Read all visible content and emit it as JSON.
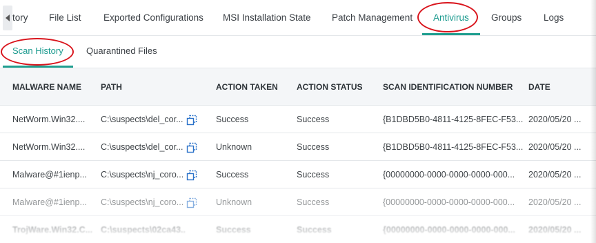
{
  "tabs": [
    {
      "label": "tory"
    },
    {
      "label": "File List"
    },
    {
      "label": "Exported Configurations"
    },
    {
      "label": "MSI Installation State"
    },
    {
      "label": "Patch Management"
    },
    {
      "label": "Antivirus",
      "active": true
    },
    {
      "label": "Groups"
    },
    {
      "label": "Logs"
    }
  ],
  "subtabs": [
    {
      "label": "Scan History",
      "active": true
    },
    {
      "label": "Quarantined Files"
    }
  ],
  "table": {
    "columns": [
      "MALWARE NAME",
      "PATH",
      "ACTION TAKEN",
      "ACTION STATUS",
      "SCAN IDENTIFICATION NUMBER",
      "DATE"
    ],
    "rows": [
      {
        "name": "NetWorm.Win32....",
        "path": "C:\\suspects\\del_cor...",
        "action": "Success",
        "status": "Success",
        "scan_id": "{B1DBD5B0-4811-4125-8FEC-F53...",
        "date": "2020/05/20 ..."
      },
      {
        "name": "NetWorm.Win32....",
        "path": "C:\\suspects\\del_cor...",
        "action": "Unknown",
        "status": "Success",
        "scan_id": "{B1DBD5B0-4811-4125-8FEC-F53...",
        "date": "2020/05/20 ..."
      },
      {
        "name": "Malware@#1ienp...",
        "path": "C:\\suspects\\nj_coro...",
        "action": "Success",
        "status": "Success",
        "scan_id": "{00000000-0000-0000-0000-000...",
        "date": "2020/05/20 ..."
      },
      {
        "name": "Malware@#1ienp...",
        "path": "C:\\suspects\\nj_coro...",
        "action": "Unknown",
        "status": "Success",
        "scan_id": "{00000000-0000-0000-0000-000...",
        "date": "2020/05/20 ..."
      },
      {
        "name": "TrojWare.Win32.C...",
        "path": "C:\\suspects\\02ca43...",
        "action": "Success",
        "status": "Success",
        "scan_id": "{00000000-0000-0000-0000-000...",
        "date": "2020/05/20 ..."
      }
    ]
  },
  "colors": {
    "accent": "#1a9a8e",
    "annotation": "#d9141c",
    "header_bg": "#f4f6f8"
  },
  "icons": {
    "scroll_left": "chevron-left-icon",
    "copy": "copy-path-icon"
  }
}
